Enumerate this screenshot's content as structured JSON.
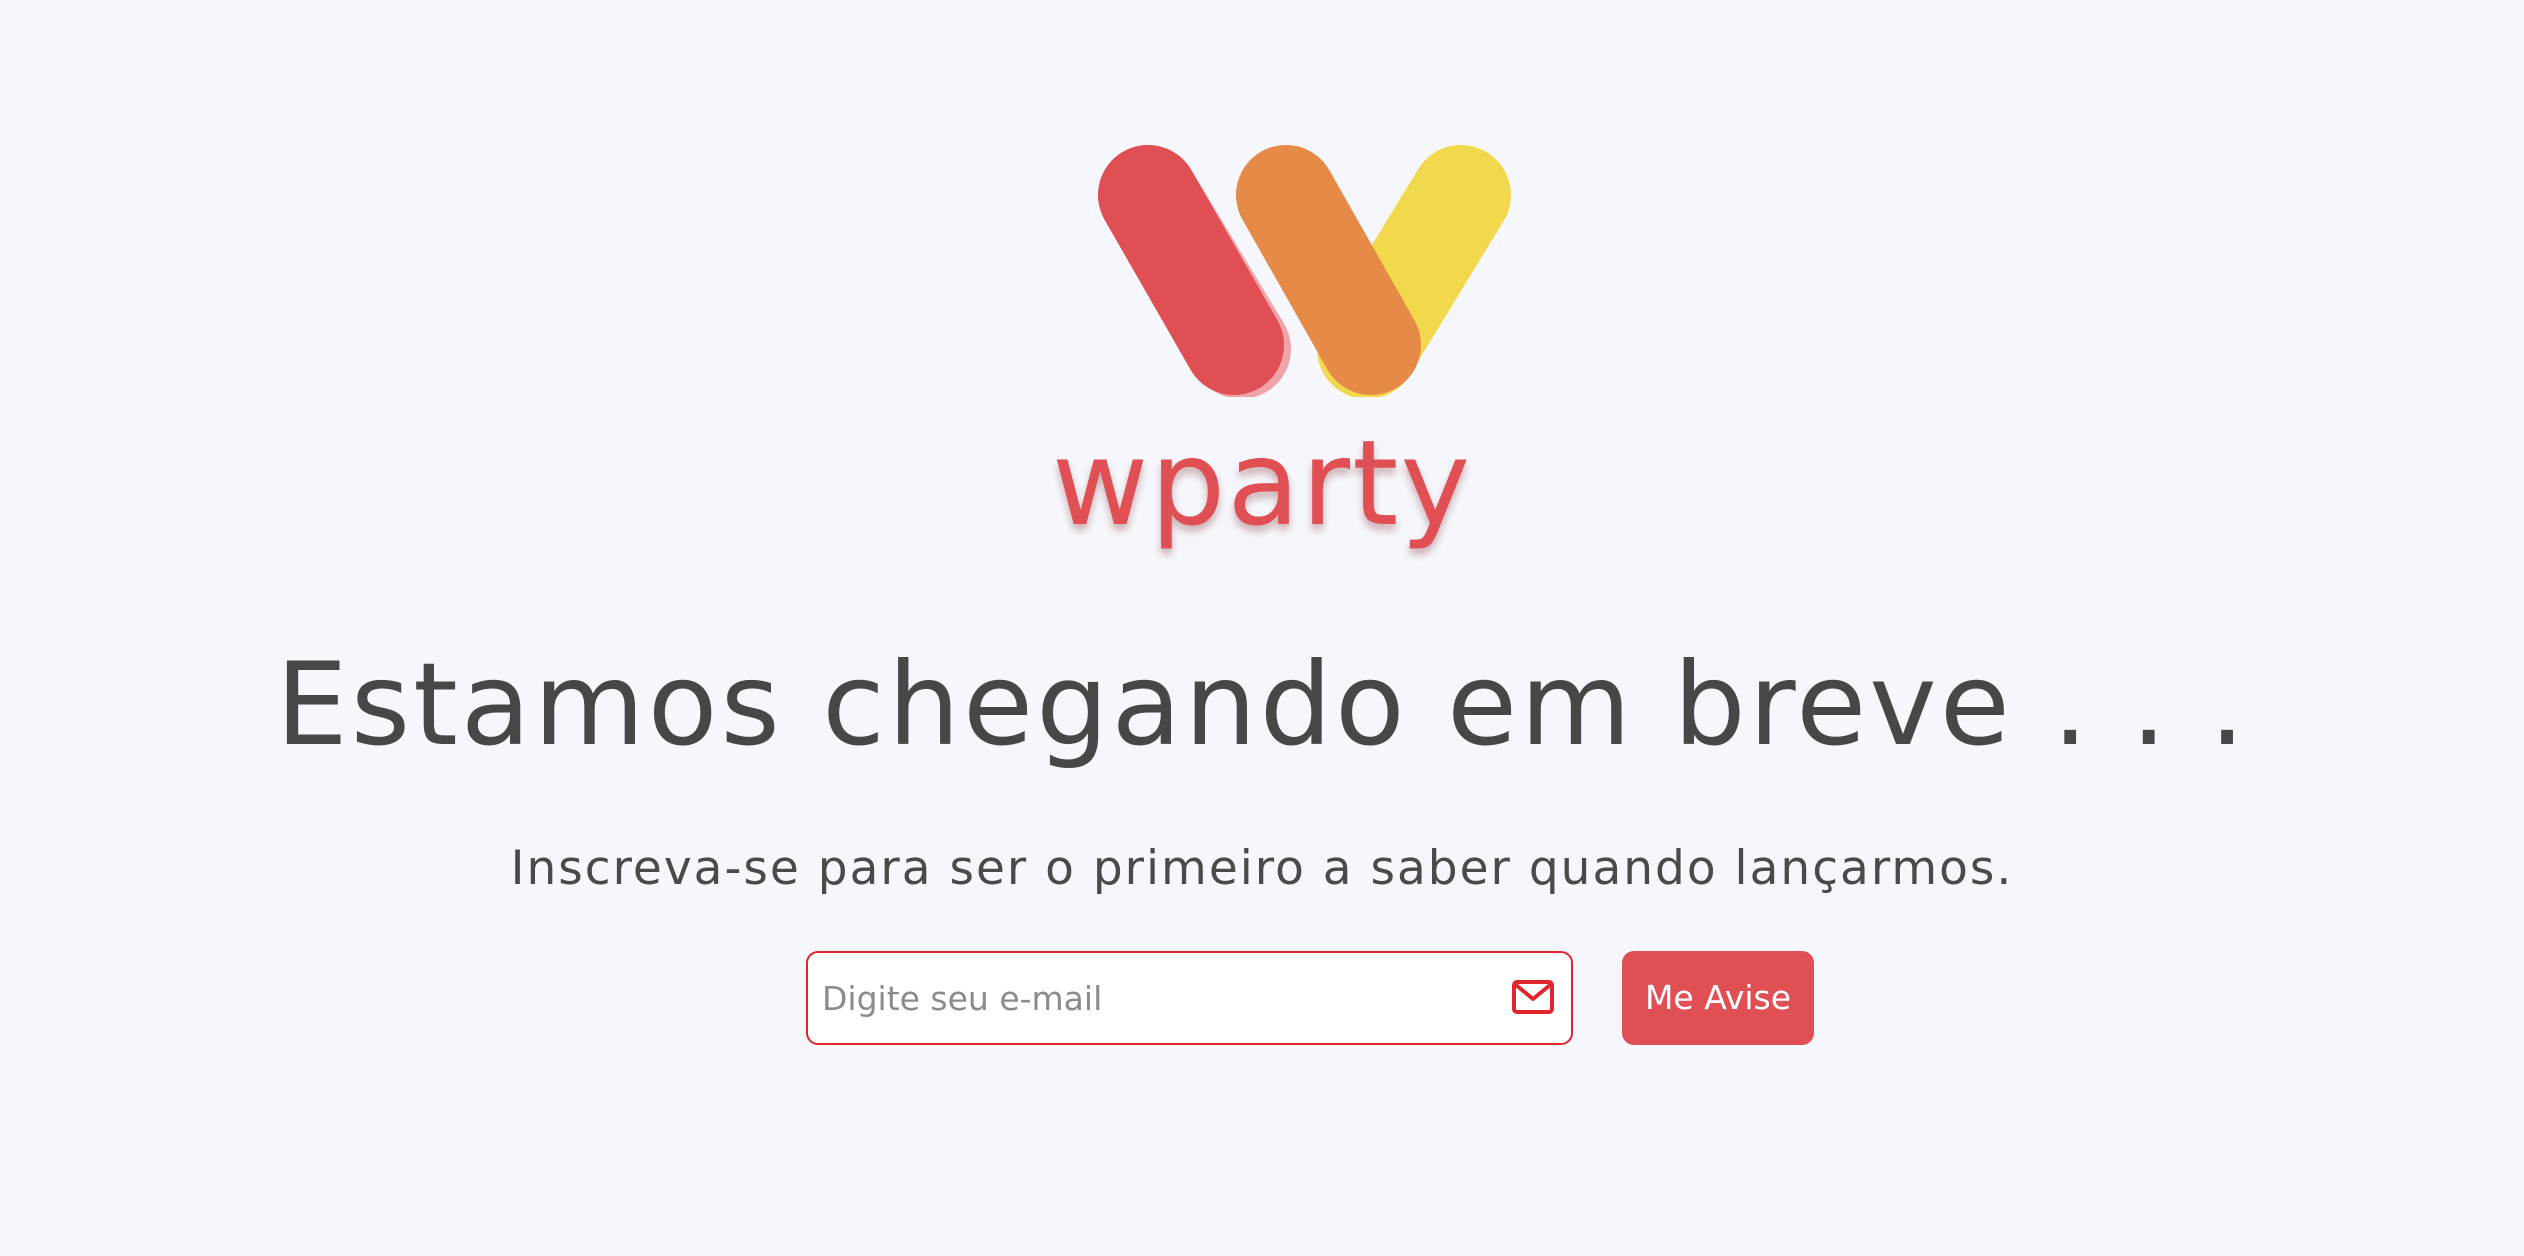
{
  "brand": {
    "name": "wparty",
    "logo_icon": "wparty-w-logo",
    "colors": {
      "red": "#e04f53",
      "orange": "#e58a47",
      "yellow": "#f1d84c",
      "pink": "#f0a4aa"
    }
  },
  "hero": {
    "headline": "Estamos chegando em breve . . .",
    "subtitle": "Inscreva-se para ser o primeiro a saber quando lançarmos."
  },
  "signup": {
    "email_placeholder": "Digite seu e-mail",
    "email_value": "",
    "email_icon": "envelope-icon",
    "button_label": "Me Avise",
    "accent_color": "#e04f53",
    "border_color": "#e0262c"
  },
  "page": {
    "background": "#f6f7fc",
    "text_color": "#474747"
  }
}
